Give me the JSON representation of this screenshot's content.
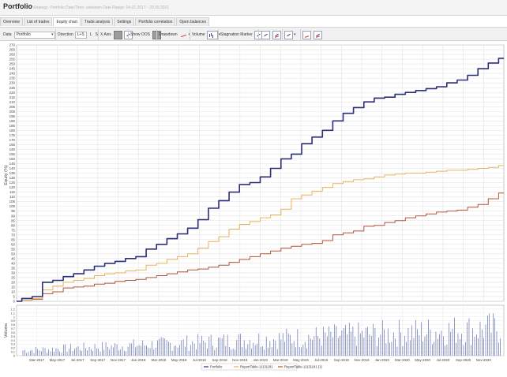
{
  "window": {
    "title": "Portfolio",
    "subtitle": "Strategy: Portfolio   Date/Time: unknown   Date Range: 04.01.2017 - 20.09.2021"
  },
  "tabs": [
    {
      "label": "Overview",
      "active": false
    },
    {
      "label": "List of trades",
      "active": false
    },
    {
      "label": "Equity chart",
      "active": true
    },
    {
      "label": "Trade analysis",
      "active": false
    },
    {
      "label": "Settings",
      "active": false
    },
    {
      "label": "Portfolio correlation",
      "active": false
    },
    {
      "label": "Open balances",
      "active": false
    }
  ],
  "toolbar": {
    "data_label": "Data",
    "data_value": "Portfolio",
    "direction_label": "Direction",
    "direction_options": [
      "L+S",
      "L",
      "S"
    ],
    "xaxis_label": "X Axis",
    "show_oos_label": "Show OOS",
    "drawdown_label": "Drawdown",
    "volume_label": "Volume",
    "stagnation_label": "Stagnation Marker"
  },
  "chart_data": {
    "type": "line",
    "ylabel": "Equity (%)",
    "ylim": [
      0,
      270
    ],
    "yticks": [
      "0",
      "5",
      "10",
      "15",
      "20",
      "25",
      "30",
      "35",
      "40",
      "45",
      "50",
      "55",
      "60",
      "65",
      "70",
      "75",
      "80",
      "85",
      "90",
      "95",
      "100",
      "105",
      "110",
      "115",
      "120",
      "125",
      "130",
      "135",
      "140",
      "145",
      "150",
      "155",
      "160",
      "165",
      "170",
      "175",
      "180",
      "185",
      "190",
      "195",
      "200",
      "205",
      "210",
      "215",
      "220",
      "225",
      "230",
      "235",
      "240",
      "245",
      "250",
      "255",
      "260",
      "265",
      "270"
    ],
    "xticks": [
      "Mar-2017",
      "May-2017",
      "Jul-2017",
      "Sep-2017",
      "Nov-2017",
      "Jan-2018",
      "Mar-2018",
      "May-2018",
      "Jul-2018",
      "Sep-2018",
      "Nov-2018",
      "Jan-2019",
      "Mar-2019",
      "May-2019",
      "Jul-2019",
      "Sep-2019",
      "Nov-2019",
      "Jan-2020",
      "Mar-2020",
      "May-2020",
      "Jul-2020",
      "Sep-2020",
      "Nov-2020"
    ],
    "x_start_month": "Jan-2017",
    "x_end_month": "Dec-2020",
    "grid": true,
    "legend_position": "bottom",
    "series": [
      {
        "name": "Portfolio",
        "color": "#2b2e7a",
        "points": [
          [
            0,
            0
          ],
          [
            1,
            3
          ],
          [
            2,
            5
          ],
          [
            3,
            20
          ],
          [
            4,
            22
          ],
          [
            5,
            26
          ],
          [
            6,
            29
          ],
          [
            7,
            33
          ],
          [
            8,
            37
          ],
          [
            9,
            40
          ],
          [
            10,
            42
          ],
          [
            11,
            45
          ],
          [
            12,
            47
          ],
          [
            13,
            55
          ],
          [
            14,
            60
          ],
          [
            15,
            66
          ],
          [
            16,
            71
          ],
          [
            17,
            77
          ],
          [
            18,
            86
          ],
          [
            19,
            98
          ],
          [
            20,
            106
          ],
          [
            21,
            115
          ],
          [
            22,
            123
          ],
          [
            23,
            125
          ],
          [
            24,
            131
          ],
          [
            25,
            140
          ],
          [
            26,
            150
          ],
          [
            27,
            155
          ],
          [
            28,
            166
          ],
          [
            29,
            173
          ],
          [
            30,
            180
          ],
          [
            31,
            190
          ],
          [
            32,
            198
          ],
          [
            33,
            204
          ],
          [
            34,
            210
          ],
          [
            35,
            214
          ],
          [
            36,
            215
          ],
          [
            37,
            218
          ],
          [
            38,
            220
          ],
          [
            39,
            222
          ],
          [
            40,
            224
          ],
          [
            41,
            226
          ],
          [
            42,
            230
          ],
          [
            43,
            233
          ],
          [
            44,
            238
          ],
          [
            45,
            245
          ],
          [
            46,
            251
          ],
          [
            47,
            256
          ]
        ]
      },
      {
        "name": "ReportTable-11131181",
        "color": "#e8b35a",
        "points": [
          [
            0,
            0
          ],
          [
            1,
            1
          ],
          [
            2,
            3
          ],
          [
            3,
            12
          ],
          [
            4,
            16
          ],
          [
            5,
            20
          ],
          [
            6,
            22
          ],
          [
            7,
            24
          ],
          [
            8,
            27
          ],
          [
            9,
            29
          ],
          [
            10,
            30
          ],
          [
            11,
            32
          ],
          [
            12,
            33
          ],
          [
            13,
            38
          ],
          [
            14,
            40
          ],
          [
            15,
            44
          ],
          [
            16,
            47
          ],
          [
            17,
            50
          ],
          [
            18,
            56
          ],
          [
            19,
            63
          ],
          [
            20,
            68
          ],
          [
            21,
            76
          ],
          [
            22,
            81
          ],
          [
            23,
            84
          ],
          [
            24,
            88
          ],
          [
            25,
            91
          ],
          [
            26,
            97
          ],
          [
            27,
            108
          ],
          [
            28,
            112
          ],
          [
            29,
            116
          ],
          [
            30,
            120
          ],
          [
            31,
            124
          ],
          [
            32,
            126
          ],
          [
            33,
            128
          ],
          [
            34,
            129
          ],
          [
            35,
            131
          ],
          [
            36,
            133
          ],
          [
            37,
            134
          ],
          [
            38,
            135
          ],
          [
            39,
            135
          ],
          [
            40,
            136
          ],
          [
            41,
            137
          ],
          [
            42,
            138
          ],
          [
            43,
            138
          ],
          [
            44,
            139
          ],
          [
            45,
            140
          ],
          [
            46,
            141
          ],
          [
            47,
            143
          ]
        ]
      },
      {
        "name": "ReportTable-11131181 (1)",
        "color": "#b3543a",
        "points": [
          [
            0,
            0
          ],
          [
            1,
            1
          ],
          [
            2,
            2
          ],
          [
            3,
            8
          ],
          [
            4,
            10
          ],
          [
            5,
            14
          ],
          [
            6,
            15
          ],
          [
            7,
            16
          ],
          [
            8,
            18
          ],
          [
            9,
            19
          ],
          [
            10,
            21
          ],
          [
            11,
            22
          ],
          [
            12,
            23
          ],
          [
            13,
            25
          ],
          [
            14,
            27
          ],
          [
            15,
            29
          ],
          [
            16,
            31
          ],
          [
            17,
            33
          ],
          [
            18,
            34
          ],
          [
            19,
            36
          ],
          [
            20,
            38
          ],
          [
            21,
            41
          ],
          [
            22,
            44
          ],
          [
            23,
            47
          ],
          [
            24,
            50
          ],
          [
            25,
            53
          ],
          [
            26,
            56
          ],
          [
            27,
            58
          ],
          [
            28,
            60
          ],
          [
            29,
            61
          ],
          [
            30,
            64
          ],
          [
            31,
            70
          ],
          [
            32,
            72
          ],
          [
            33,
            74
          ],
          [
            34,
            79
          ],
          [
            35,
            80
          ],
          [
            36,
            83
          ],
          [
            37,
            85
          ],
          [
            38,
            88
          ],
          [
            39,
            90
          ],
          [
            40,
            92
          ],
          [
            41,
            94
          ],
          [
            42,
            95
          ],
          [
            43,
            96
          ],
          [
            44,
            99
          ],
          [
            45,
            102
          ],
          [
            46,
            108
          ],
          [
            47,
            114
          ]
        ]
      }
    ],
    "volume": {
      "ylabel": "Volume",
      "ylim": [
        0,
        1.3
      ],
      "yticks": [
        "0",
        "0.1",
        "0.2",
        "0.3",
        "0.4",
        "0.5",
        "0.6",
        "0.7",
        "0.8",
        "0.9",
        "1",
        "1.1",
        "1.2"
      ]
    }
  }
}
